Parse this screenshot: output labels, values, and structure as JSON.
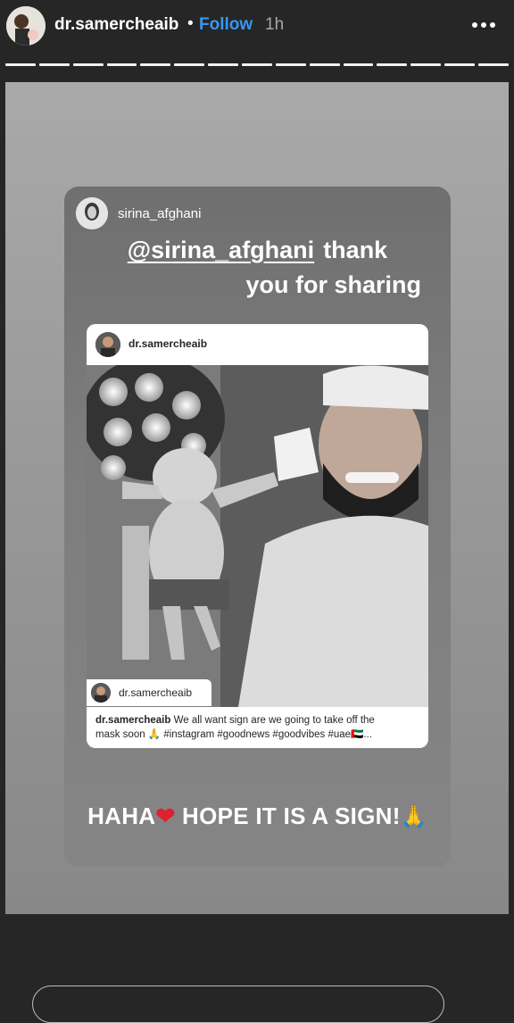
{
  "header": {
    "username": "dr.samercheaib",
    "separator": "•",
    "follow_label": "Follow",
    "time": "1h",
    "progress_segments": 15
  },
  "reply": {
    "username": "sirina_afghani",
    "mention": "@sirina_afghani",
    "line1_rest": "thank",
    "line2": "you for sharing",
    "bottom_text_a": "HAHA",
    "bottom_text_b": "HOPE IT IS A SIGN!",
    "heart": "❤",
    "pray": "🙏"
  },
  "post": {
    "username": "dr.samercheaib",
    "tag_username": "dr.samercheaib",
    "caption_user": "dr.samercheaib",
    "caption_line1": "We all want sign are we going to take off the",
    "caption_line2": "mask soon 🙏 #instagram #goodnews #goodvibes #uae🇦🇪..."
  },
  "colors": {
    "follow": "#3897f0",
    "background": "#262626",
    "heart": "#e0202c"
  }
}
